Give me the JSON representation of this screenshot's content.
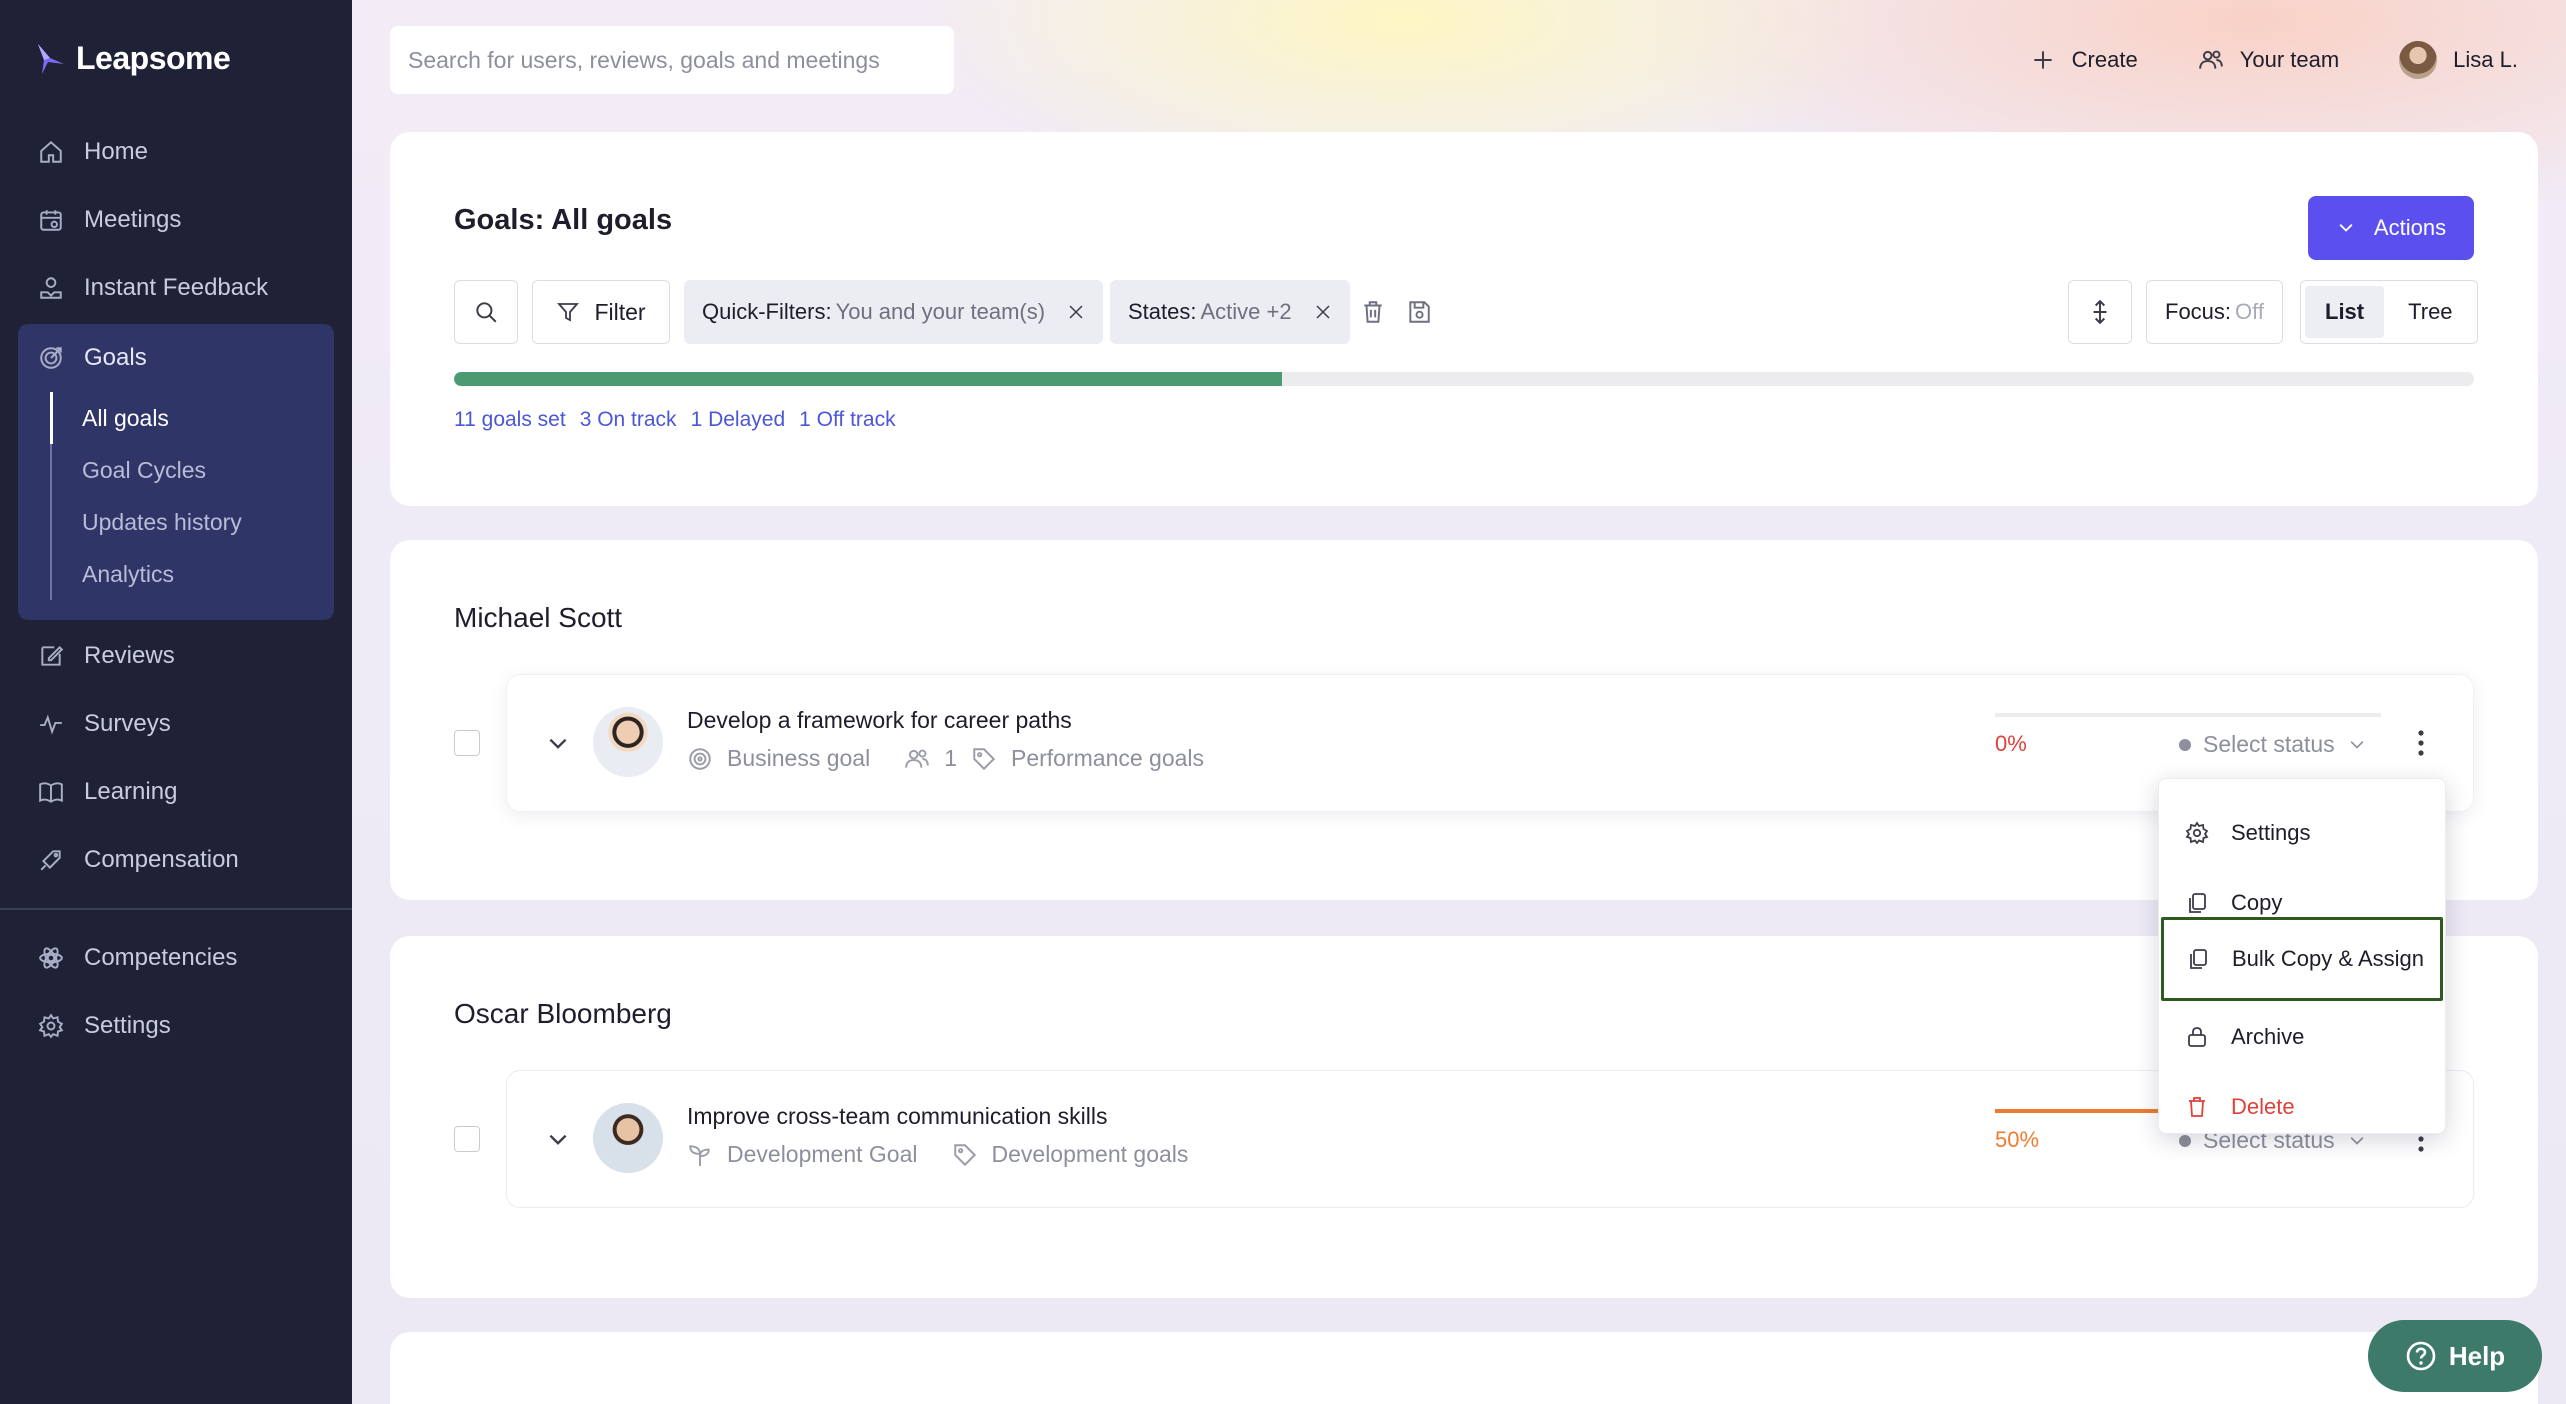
{
  "app": {
    "name": "Leapsome",
    "brand_color": "#5b4ff0",
    "sidebar_color": "#1f2237"
  },
  "sidebar": {
    "items": [
      {
        "label": "Home",
        "icon": "home-icon"
      },
      {
        "label": "Meetings",
        "icon": "meetings-icon"
      },
      {
        "label": "Instant Feedback",
        "icon": "feedback-icon"
      },
      {
        "label": "Goals",
        "icon": "goals-icon",
        "active": true,
        "children": [
          {
            "label": "All goals",
            "active": true
          },
          {
            "label": "Goal Cycles"
          },
          {
            "label": "Updates history"
          },
          {
            "label": "Analytics"
          }
        ]
      },
      {
        "label": "Reviews",
        "icon": "reviews-icon"
      },
      {
        "label": "Surveys",
        "icon": "surveys-icon"
      },
      {
        "label": "Learning",
        "icon": "book-icon"
      },
      {
        "label": "Compensation",
        "icon": "compensation-icon"
      }
    ],
    "bottom_items": [
      {
        "label": "Competencies",
        "icon": "competencies-icon"
      },
      {
        "label": "Settings",
        "icon": "gear-icon"
      }
    ]
  },
  "topbar": {
    "search_placeholder": "Search for users, reviews, goals and meetings",
    "create_label": "Create",
    "team_label": "Your team",
    "user_label": "Lisa L."
  },
  "goals_header": {
    "title": "Goals: All goals",
    "actions_label": "Actions",
    "filter_label": "Filter",
    "quick_filters_label": "Quick-Filters:",
    "quick_filters_value": "You and your team(s)",
    "states_label": "States:",
    "states_value": "Active +2",
    "focus_label": "Focus:",
    "focus_value": "Off",
    "view_list": "List",
    "view_tree": "Tree",
    "progress_fraction": 0.41,
    "progress_color": "#4c9a72",
    "stats": [
      "11 goals set",
      "3 On track",
      "1 Delayed",
      "1 Off track"
    ]
  },
  "groups": [
    {
      "owner": "Michael Scott",
      "goal": {
        "title": "Develop a framework for career paths",
        "type": "Business goal",
        "owners_count": "1",
        "category": "Performance goals",
        "progress_pct": "0%",
        "progress_fraction": 0,
        "pct_color": "#e0413b",
        "status": "Select status"
      }
    },
    {
      "owner": "Oscar Bloomberg",
      "goal": {
        "title": "Improve cross-team communication skills",
        "type": "Development Goal",
        "category": "Development goals",
        "progress_pct": "50%",
        "progress_fraction": 0.5,
        "pct_color": "#ef7b2e",
        "status": "Select status"
      }
    }
  ],
  "context_menu": {
    "items": [
      {
        "label": "Settings",
        "icon": "gear-icon"
      },
      {
        "label": "Copy",
        "icon": "copy-icon"
      },
      {
        "label": "Bulk Copy & Assign",
        "icon": "copy-icon",
        "highlighted": true
      },
      {
        "label": "Archive",
        "icon": "lock-icon"
      },
      {
        "label": "Delete",
        "icon": "trash-icon",
        "danger": true
      }
    ]
  },
  "help": {
    "label": "Help"
  }
}
